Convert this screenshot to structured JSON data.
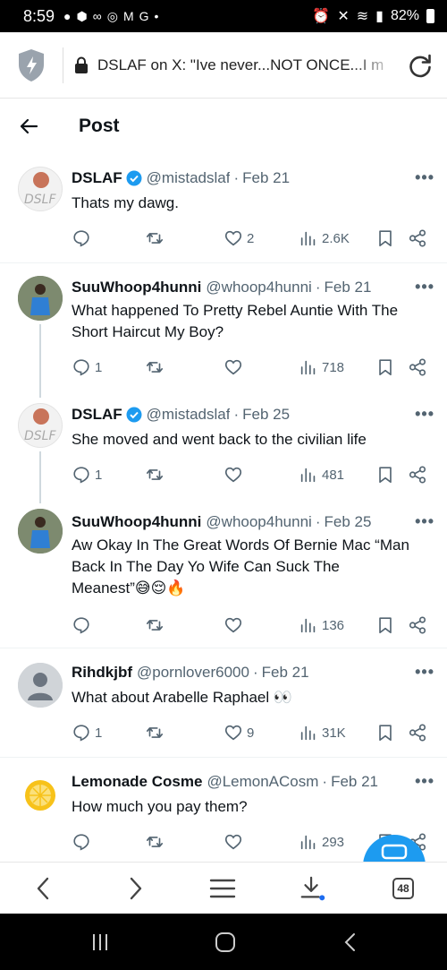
{
  "status_bar": {
    "time": "8:59",
    "battery": "82%"
  },
  "browser": {
    "url": "DSLAF on X: \"Ive never...NOT ONCE...I m",
    "tab_count": "48"
  },
  "header": {
    "title": "Post"
  },
  "tweets": [
    {
      "name": "DSLAF",
      "verified": true,
      "handle": "@mistadslaf",
      "date": "Feb 21",
      "text": "Thats my dawg.",
      "replies": "",
      "retweets": "",
      "likes": "2",
      "views": "2.6K"
    },
    {
      "name": "SuuWhoop4hunni",
      "verified": false,
      "handle": "@whoop4hunni",
      "date": "Feb 21",
      "text": "What happened To Pretty Rebel Auntie With The Short Haircut My Boy?",
      "replies": "1",
      "retweets": "",
      "likes": "",
      "views": "718"
    },
    {
      "name": "DSLAF",
      "verified": true,
      "handle": "@mistadslaf",
      "date": "Feb 25",
      "text": "She moved and went back to the civilian life",
      "replies": "1",
      "retweets": "",
      "likes": "",
      "views": "481"
    },
    {
      "name": "SuuWhoop4hunni",
      "verified": false,
      "handle": "@whoop4hunni",
      "date": "Feb 25",
      "text": "Aw Okay In The Great Words Of Bernie Mac “Man Back In The Day Yo Wife Can Suck The Meanest”😅😌🔥",
      "replies": "",
      "retweets": "",
      "likes": "",
      "views": "136"
    },
    {
      "name": "Rihdkjbf",
      "verified": false,
      "handle": "@pornlover6000",
      "date": "Feb 21",
      "text": "What about Arabelle Raphael 👀",
      "replies": "1",
      "retweets": "",
      "likes": "9",
      "views": "31K"
    },
    {
      "name": "Lemonade Cosme",
      "verified": false,
      "handle": "@LemonACosm",
      "date": "Feb 21",
      "text": "How much you pay them?",
      "replies": "",
      "retweets": "",
      "likes": "",
      "views": "293"
    }
  ],
  "colors": {
    "accent": "#1d9bf0",
    "secondary_text": "#536471",
    "divider": "#eff3f4"
  },
  "icons": [
    "shield-icon",
    "lock-icon",
    "reload-icon",
    "back-arrow-icon",
    "verified-badge-icon",
    "reply-icon",
    "retweet-icon",
    "like-icon",
    "views-icon",
    "bookmark-icon",
    "share-icon",
    "more-icon",
    "compose-icon",
    "chevron-left-icon",
    "chevron-right-icon",
    "menu-icon",
    "download-icon",
    "tabs-icon"
  ]
}
